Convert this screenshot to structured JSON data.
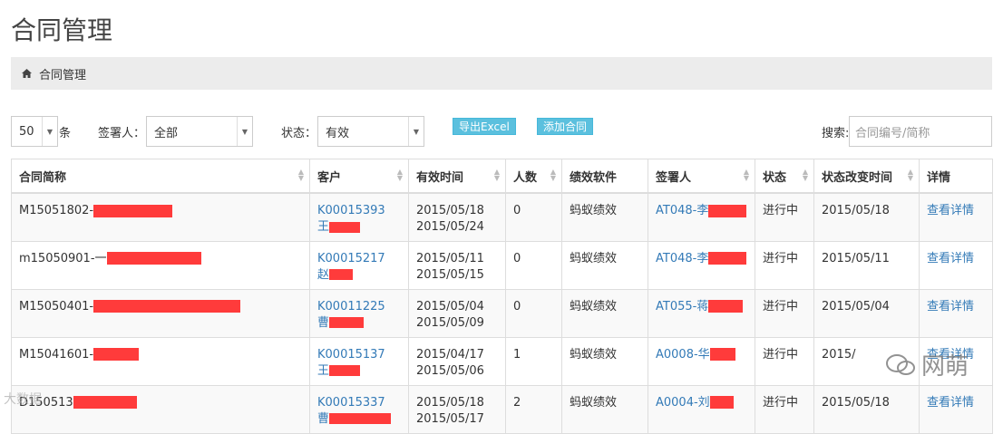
{
  "page_title": "合同管理",
  "breadcrumb": {
    "icon": "home-icon",
    "label": "合同管理"
  },
  "toolbar": {
    "page_size": "50",
    "page_size_suffix": "条",
    "signer_label": "签署人：",
    "signer_value": "全部",
    "status_label": "状态：",
    "status_value": "有效",
    "export_button": "导出Excel",
    "add_button": "添加合同",
    "search_label": "搜索:",
    "search_placeholder": "合同编号/简称"
  },
  "table": {
    "headers": [
      "合同简称",
      "客户",
      "有效时间",
      "人数",
      "绩效软件",
      "签署人",
      "状态",
      "状态改变时间",
      "详情"
    ],
    "rows": [
      {
        "name": "M15051802-",
        "customer_code": "K00015393",
        "customer_name": "王",
        "start": "2015/05/18",
        "end": "2015/05/24",
        "count": "0",
        "software": "蚂蚁绩效",
        "signer": "AT048-李",
        "status": "进行中",
        "changed": "2015/05/18",
        "detail": "查看详情"
      },
      {
        "name": "m15050901-一",
        "customer_code": "K00015217",
        "customer_name": "赵",
        "start": "2015/05/11",
        "end": "2015/05/15",
        "count": "0",
        "software": "蚂蚁绩效",
        "signer": "AT048-李",
        "status": "进行中",
        "changed": "2015/05/11",
        "detail": "查看详情"
      },
      {
        "name": "M15050401-",
        "customer_code": "K00011225",
        "customer_name": "曹",
        "start": "2015/05/04",
        "end": "2015/05/09",
        "count": "0",
        "software": "蚂蚁绩效",
        "signer": "AT055-蒋",
        "status": "进行中",
        "changed": "2015/05/04",
        "detail": "查看详情"
      },
      {
        "name": "M15041601-",
        "customer_code": "K00015137",
        "customer_name": "王",
        "start": "2015/04/17",
        "end": "2015/05/06",
        "count": "1",
        "software": "蚂蚁绩效",
        "signer": "A0008-华",
        "status": "进行中",
        "changed": "2015/",
        "detail": "查看详情"
      },
      {
        "name": "D150513",
        "customer_code": "K00015337",
        "customer_name": "曹",
        "start": "2015/05/18",
        "end": "2015/05/17",
        "count": "2",
        "software": "蚂蚁绩效",
        "signer": "A0004-刘",
        "status": "进行中",
        "changed": "2015/05/18",
        "detail": "查看详情"
      }
    ]
  },
  "watermark": {
    "text": "网萌",
    "icon": "wechat-icon",
    "left_text": "大数据"
  },
  "colors": {
    "link": "#337ab7",
    "button": "#5bc0de",
    "redaction": "#ff3b3b",
    "breadcrumb_bg": "#ececec"
  }
}
